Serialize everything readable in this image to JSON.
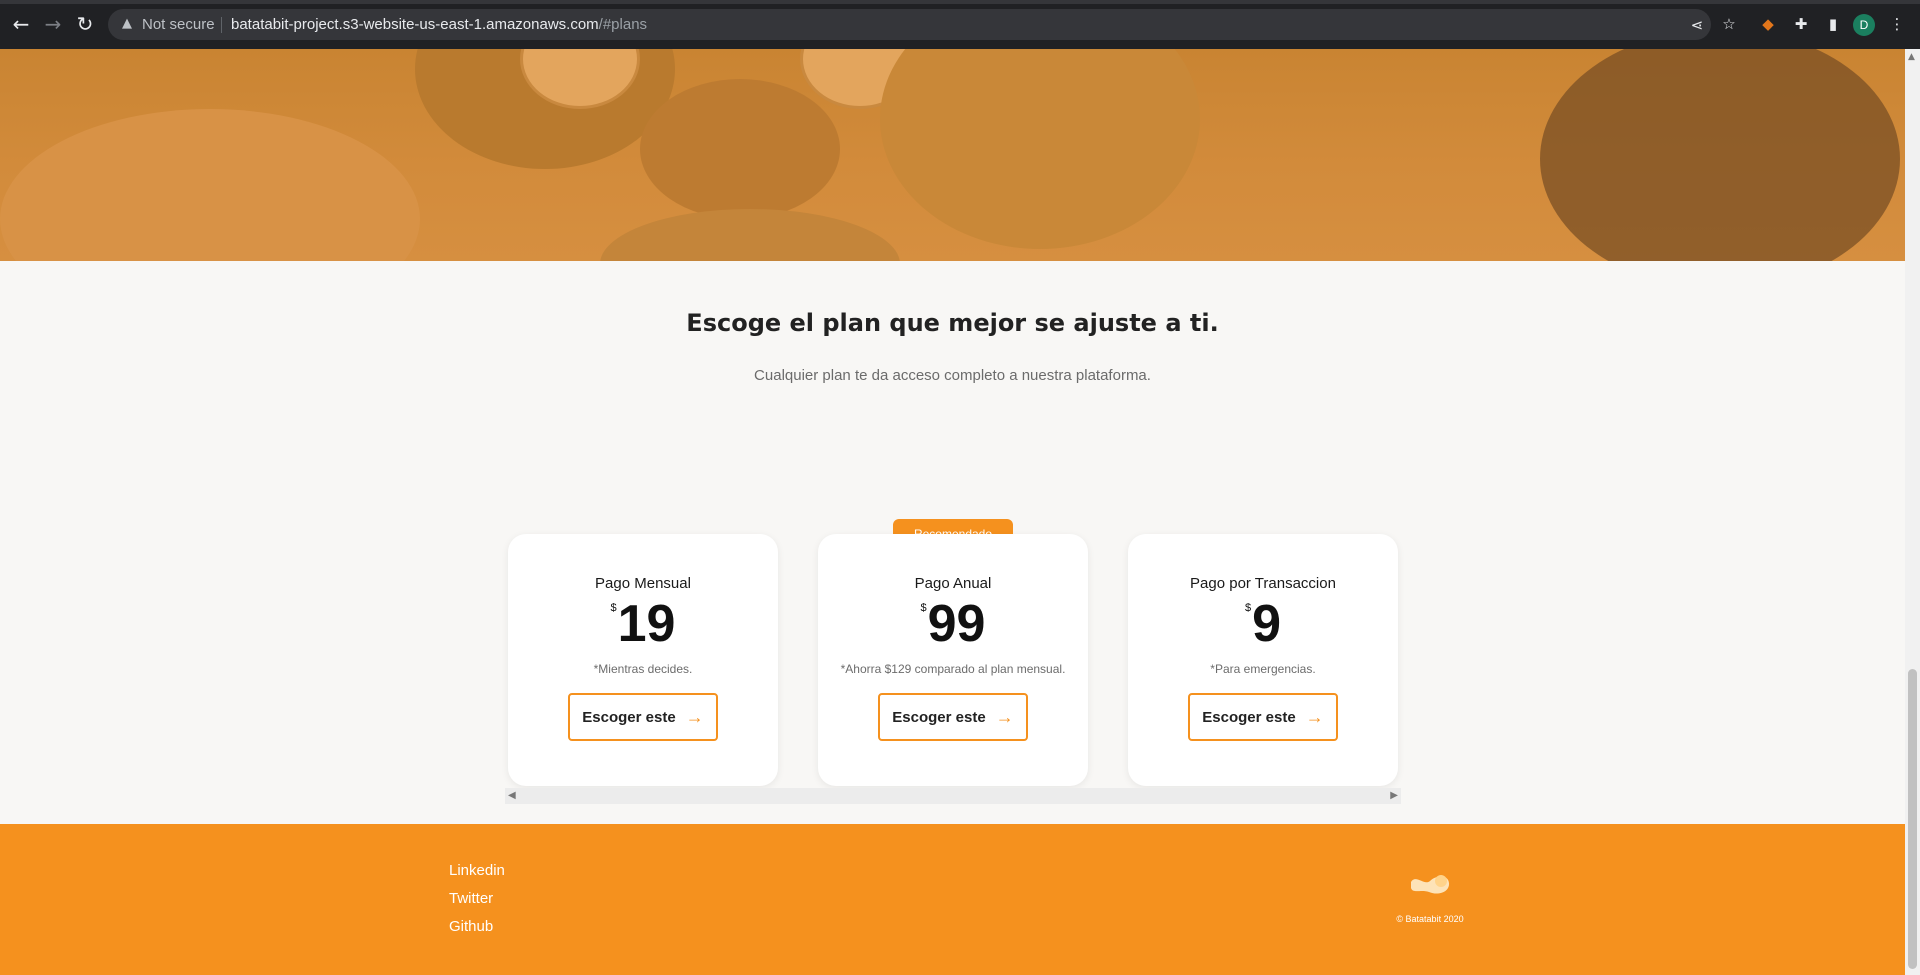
{
  "browser": {
    "back_icon": "arrow-left-icon",
    "forward_icon": "arrow-right-icon",
    "reload_icon": "reload-icon",
    "security_label": "Not secure",
    "url_main": "batatabit-project.s3-website-us-east-1.amazonaws.com",
    "url_fragment": "/#plans",
    "avatar_letter": "D"
  },
  "plans": {
    "title": "Escoge el plan que mejor se ajuste a ti.",
    "subtitle": "Cualquier plan te da acceso completo a nuestra plataforma.",
    "recommended_badge": "Recomendado",
    "currency": "$",
    "cards": [
      {
        "title": "Pago Mensual",
        "price": "19",
        "note": "*Mientras decides.",
        "button": "Escoger este"
      },
      {
        "title": "Pago Anual",
        "price": "99",
        "note": "*Ahorra $129 comparado al plan mensual.",
        "button": "Escoger este"
      },
      {
        "title": "Pago por Transaccion",
        "price": "9",
        "note": "*Para emergencias.",
        "button": "Escoger este"
      }
    ]
  },
  "footer": {
    "links": [
      "Linkedin",
      "Twitter",
      "Github"
    ],
    "copyright": "© Batatabit 2020"
  },
  "colors": {
    "accent": "#f5911e",
    "hero": "#d28b3b",
    "background": "#f8f7f5"
  }
}
